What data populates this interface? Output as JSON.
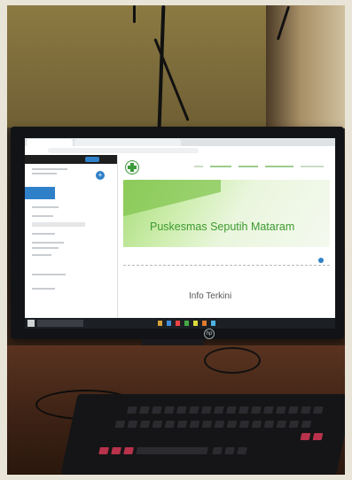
{
  "screen": {
    "hero_title": "Puskesmas Seputih Mataram",
    "section_title": "Info Terkini"
  },
  "monitor": {
    "brand": "hp"
  }
}
